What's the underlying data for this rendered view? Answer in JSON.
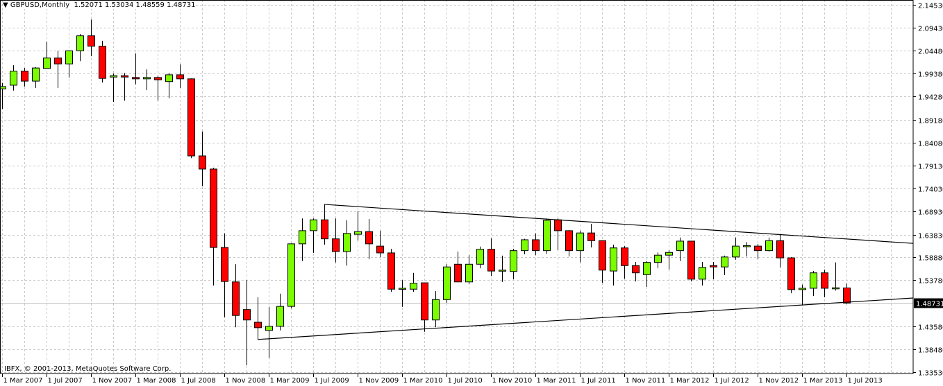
{
  "header": {
    "menu_icon": "triangle-down-icon",
    "symbol": "GBPUSD,Monthly",
    "quote": "1.52071 1.53034 1.48559 1.48731"
  },
  "footer": {
    "copyright": "IBFX, © 2001-2013, MetaQuotes Software Corp."
  },
  "colors": {
    "up": "#7CFC00",
    "down": "#FF0000",
    "outline": "#000000",
    "grid": "#C8C8C8",
    "current_price_bg": "#000000"
  },
  "chart_data": {
    "type": "candlestick",
    "title": "GBPUSD,Monthly",
    "last_bar": {
      "open": 1.52071,
      "high": 1.53034,
      "low": 1.48559,
      "close": 1.48731
    },
    "current_price": "1.48731",
    "ylim": [
      1.3353,
      2.1453
    ],
    "grid": true,
    "y_ticks": [
      "2.14530",
      "2.09430",
      "2.04480",
      "1.99380",
      "1.94280",
      "1.89180",
      "1.84080",
      "1.79130",
      "1.74030",
      "1.68930",
      "1.63830",
      "1.58880",
      "1.53780",
      "1.43580",
      "1.38480",
      "1.33530"
    ],
    "x_ticks": [
      "1 Mar 2007",
      "1 Jul 2007",
      "1 Nov 2007",
      "1 Mar 2008",
      "1 Jul 2008",
      "1 Nov 2008",
      "1 Mar 2009",
      "1 Jul 2009",
      "1 Nov 2009",
      "1 Mar 2010",
      "1 Jul 2010",
      "1 Nov 2010",
      "1 Mar 2011",
      "1 Jul 2011",
      "1 Nov 2011",
      "1 Mar 2012",
      "1 Jul 2012",
      "1 Nov 2012",
      "1 Mar 2013",
      "1 Jul 2013"
    ],
    "start_month": "2007-03",
    "ohlc": [
      [
        1.96,
        1.973,
        1.916,
        1.965
      ],
      [
        1.968,
        2.012,
        1.956,
        1.999
      ],
      [
        1.999,
        2.006,
        1.965,
        1.977
      ],
      [
        1.977,
        2.008,
        1.962,
        2.006
      ],
      [
        2.005,
        2.064,
        2.005,
        2.028
      ],
      [
        2.028,
        2.044,
        1.962,
        2.015
      ],
      [
        2.015,
        2.044,
        1.985,
        2.044
      ],
      [
        2.044,
        2.081,
        2.021,
        2.077
      ],
      [
        2.077,
        2.113,
        2.032,
        2.054
      ],
      [
        2.054,
        2.066,
        1.974,
        1.983
      ],
      [
        1.986,
        1.994,
        1.931,
        1.989
      ],
      [
        1.989,
        1.995,
        1.934,
        1.986
      ],
      [
        1.985,
        2.038,
        1.97,
        1.982
      ],
      [
        1.982,
        2.003,
        1.957,
        1.985
      ],
      [
        1.985,
        1.989,
        1.934,
        1.98
      ],
      [
        1.976,
        1.995,
        1.939,
        1.991
      ],
      [
        1.991,
        2.014,
        1.962,
        1.982
      ],
      [
        1.982,
        1.983,
        1.807,
        1.812
      ],
      [
        1.812,
        1.866,
        1.745,
        1.783
      ],
      [
        1.783,
        1.786,
        1.526,
        1.61
      ],
      [
        1.61,
        1.641,
        1.456,
        1.535
      ],
      [
        1.534,
        1.573,
        1.434,
        1.46
      ],
      [
        1.473,
        1.538,
        1.35,
        1.45
      ],
      [
        1.445,
        1.5,
        1.407,
        1.433
      ],
      [
        1.427,
        1.479,
        1.366,
        1.436
      ],
      [
        1.436,
        1.508,
        1.427,
        1.48
      ],
      [
        1.48,
        1.619,
        1.476,
        1.618
      ],
      [
        1.618,
        1.674,
        1.58,
        1.647
      ],
      [
        1.647,
        1.674,
        1.598,
        1.671
      ],
      [
        1.671,
        1.705,
        1.616,
        1.629
      ],
      [
        1.629,
        1.674,
        1.577,
        1.601
      ],
      [
        1.601,
        1.67,
        1.57,
        1.641
      ],
      [
        1.639,
        1.69,
        1.625,
        1.645
      ],
      [
        1.645,
        1.673,
        1.584,
        1.618
      ],
      [
        1.613,
        1.647,
        1.589,
        1.598
      ],
      [
        1.598,
        1.607,
        1.512,
        1.518
      ],
      [
        1.518,
        1.538,
        1.479,
        1.52
      ],
      [
        1.518,
        1.554,
        1.512,
        1.531
      ],
      [
        1.532,
        1.532,
        1.424,
        1.45
      ],
      [
        1.45,
        1.514,
        1.434,
        1.495
      ],
      [
        1.495,
        1.573,
        1.488,
        1.567
      ],
      [
        1.573,
        1.601,
        1.534,
        1.534
      ],
      [
        1.534,
        1.593,
        1.529,
        1.573
      ],
      [
        1.573,
        1.612,
        1.564,
        1.606
      ],
      [
        1.606,
        1.63,
        1.547,
        1.558
      ],
      [
        1.558,
        1.592,
        1.534,
        1.56
      ],
      [
        1.557,
        1.607,
        1.54,
        1.603
      ],
      [
        1.603,
        1.629,
        1.595,
        1.627
      ],
      [
        1.627,
        1.641,
        1.593,
        1.603
      ],
      [
        1.603,
        1.674,
        1.596,
        1.67
      ],
      [
        1.671,
        1.674,
        1.604,
        1.647
      ],
      [
        1.647,
        1.648,
        1.59,
        1.603
      ],
      [
        1.603,
        1.647,
        1.577,
        1.642
      ],
      [
        1.642,
        1.662,
        1.61,
        1.625
      ],
      [
        1.625,
        1.625,
        1.532,
        1.56
      ],
      [
        1.558,
        1.616,
        1.526,
        1.609
      ],
      [
        1.609,
        1.613,
        1.541,
        1.57
      ],
      [
        1.57,
        1.578,
        1.535,
        1.554
      ],
      [
        1.55,
        1.58,
        1.523,
        1.577
      ],
      [
        1.577,
        1.599,
        1.564,
        1.593
      ],
      [
        1.593,
        1.604,
        1.561,
        1.599
      ],
      [
        1.603,
        1.632,
        1.58,
        1.624
      ],
      [
        1.624,
        1.624,
        1.535,
        1.54
      ],
      [
        1.54,
        1.578,
        1.526,
        1.566
      ],
      [
        1.57,
        1.578,
        1.54,
        1.567
      ],
      [
        1.567,
        1.592,
        1.549,
        1.589
      ],
      [
        1.589,
        1.632,
        1.583,
        1.613
      ],
      [
        1.613,
        1.622,
        1.59,
        1.614
      ],
      [
        1.613,
        1.618,
        1.584,
        1.603
      ],
      [
        1.603,
        1.632,
        1.601,
        1.625
      ],
      [
        1.625,
        1.639,
        1.566,
        1.587
      ],
      [
        1.587,
        1.589,
        1.509,
        1.517
      ],
      [
        1.517,
        1.528,
        1.483,
        1.52
      ],
      [
        1.52,
        1.558,
        1.503,
        1.554
      ],
      [
        1.554,
        1.561,
        1.5,
        1.52
      ],
      [
        1.521,
        1.577,
        1.515,
        1.521
      ],
      [
        1.52071,
        1.53034,
        1.48559,
        1.48731
      ]
    ],
    "trendlines": [
      {
        "name": "upper-resistance",
        "from": {
          "bar": 29,
          "price": 1.705
        },
        "to": {
          "bar": 82,
          "price": 1.619
        }
      },
      {
        "name": "lower-support",
        "from": {
          "bar": 23,
          "price": 1.407
        },
        "to": {
          "bar": 82,
          "price": 1.4985
        }
      }
    ]
  }
}
